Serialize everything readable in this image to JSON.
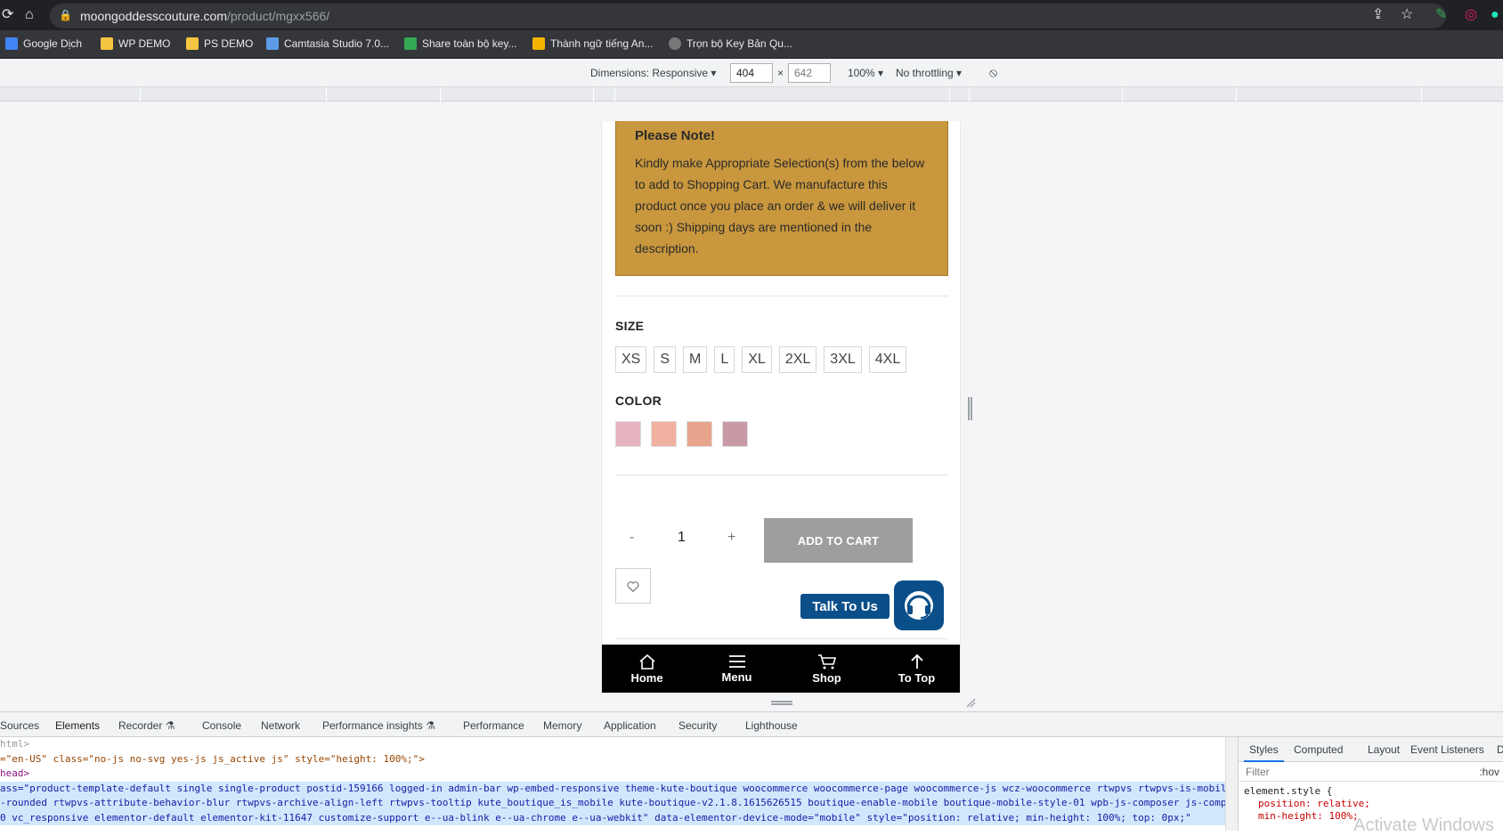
{
  "browser": {
    "url_domain": "moongoddesscouture.com",
    "url_path": "/product/mgxx566/",
    "bookmarks": [
      "Google Dịch",
      "WP DEMO",
      "PS DEMO",
      "Camtasia Studio 7.0...",
      "Share toàn bộ key...",
      "Thành ngữ tiếng An...",
      "Trọn bộ Key Bản Qu..."
    ]
  },
  "device_toolbar": {
    "dimensions_label": "Dimensions: Responsive",
    "width": "404",
    "height": "642",
    "zoom": "100%",
    "throttle": "No throttling"
  },
  "product": {
    "note_title": "Please Note!",
    "note_body": "Kindly make Appropriate Selection(s) from the below to add to Shopping Cart. We manufacture this product once you place an order & we will deliver it soon :) Shipping days are mentioned in the description.",
    "size_label": "SIZE",
    "sizes": [
      "XS",
      "S",
      "M",
      "L",
      "XL",
      "2XL",
      "3XL",
      "4XL"
    ],
    "color_label": "COLOR",
    "colors": [
      "#e8b3c0",
      "#f2b0a0",
      "#e8a48d",
      "#c89aa6"
    ],
    "qty_minus": "-",
    "qty_value": "1",
    "qty_plus": "+",
    "add_to_cart": "ADD TO CART",
    "talk_to_us": "Talk To Us"
  },
  "bottom_nav": [
    "Home",
    "Menu",
    "Shop",
    "To Top"
  ],
  "devtools": {
    "tabs": [
      "Sources",
      "Elements",
      "Recorder",
      "Console",
      "Network",
      "Performance insights",
      "Performance",
      "Memory",
      "Application",
      "Security",
      "Lighthouse"
    ],
    "code_lines": [
      "html>",
      "=\"en-US\" class=\"no-js no-svg yes-js js_active js\" style=\"height: 100%;\">",
      "head>",
      "ass=\"product-template-default single single-product postid-159166 logged-in admin-bar wp-embed-responsive theme-kute-boutique woocommerce woocommerce-page woocommerce-js wcz-woocommerce rtwpvs rtwpvs-is-mobil",
      "-rounded rtwpvs-attribute-behavior-blur rtwpvs-archive-align-left rtwpvs-tooltip kute_boutique_is_mobile kute-boutique-v2.1.8.1615626515 boutique-enable-mobile boutique-mobile-style-01 wpb-js-composer js-comp",
      "0 vc_responsive elementor-default elementor-kit-11647 customize-support e--ua-blink e--ua-chrome e--ua-webkit\" data-elementor-device-mode=\"mobile\" style=\"position: relative; min-height: 100%; top: 0px;\""
    ],
    "side_tabs": [
      "Styles",
      "Computed",
      "Layout",
      "Event Listeners",
      "D"
    ],
    "filter_placeholder": "Filter",
    "hov": ":hov",
    "style_selector": "element.style {",
    "style_props": [
      "position: relative;",
      "min-height: 100%;"
    ],
    "watermark": "Activate Windows"
  }
}
